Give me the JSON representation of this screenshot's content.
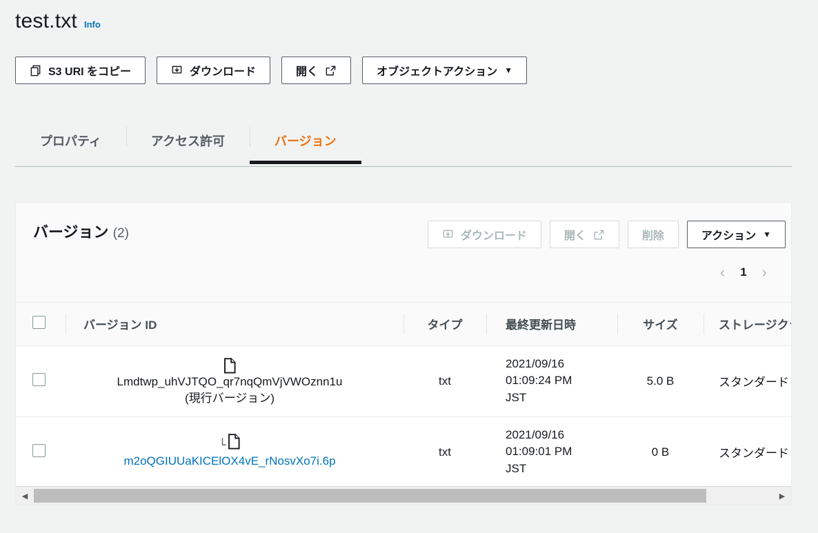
{
  "header": {
    "title": "test.txt",
    "info_label": "Info"
  },
  "toolbar": {
    "copy_uri_label": "S3 URI をコピー",
    "copy_uri_icon": "copy-icon",
    "download_label": "ダウンロード",
    "download_icon": "download-icon",
    "open_label": "開く",
    "open_icon": "external-link-icon",
    "object_actions_label": "オブジェクトアクション",
    "object_actions_caret": "▼"
  },
  "tabs": [
    {
      "label": "プロパティ",
      "active": false
    },
    {
      "label": "アクセス許可",
      "active": false
    },
    {
      "label": "バージョン",
      "active": true
    }
  ],
  "panel": {
    "title": "バージョン",
    "count": "(2)",
    "actions": {
      "download_label": "ダウンロード",
      "download_icon": "download-icon",
      "download_disabled": true,
      "open_label": "開く",
      "open_icon": "external-link-icon",
      "open_disabled": true,
      "delete_label": "削除",
      "delete_disabled": true,
      "actions_label": "アクション",
      "actions_caret": "▼"
    },
    "pagination": {
      "prev_icon": "chevron-left-icon",
      "prev_glyph": "‹",
      "page": "1",
      "next_icon": "chevron-right-icon",
      "next_glyph": "›"
    },
    "table": {
      "columns": [
        {
          "key": "checkbox",
          "label": ""
        },
        {
          "key": "version_id",
          "label": "バージョン ID"
        },
        {
          "key": "type",
          "label": "タイプ"
        },
        {
          "key": "last_modified",
          "label": "最終更新日時"
        },
        {
          "key": "size",
          "label": "サイズ"
        },
        {
          "key": "storage_class",
          "label": "ストレージクラス"
        }
      ],
      "rows": [
        {
          "version_id": "Lmdtwp_uhVJTQO_qr7nqQmVjVWOznn1u",
          "version_suffix": "(現行バージョン)",
          "is_link": false,
          "tree_glyph": "",
          "file_icon": "file-icon",
          "type": "txt",
          "date": "2021/09/16",
          "time": "01:09:24 PM",
          "timezone": "JST",
          "size": "5.0 B",
          "storage_class": "スタンダード"
        },
        {
          "version_id": "m2oQGIUUaKICElOX4vE_rNosvXo7i.6p",
          "version_suffix": "",
          "is_link": true,
          "tree_glyph": "└",
          "file_icon": "file-icon",
          "type": "txt",
          "date": "2021/09/16",
          "time": "01:09:01 PM",
          "timezone": "JST",
          "size": "0 B",
          "storage_class": "スタンダード"
        }
      ]
    },
    "scrollbar": {
      "left_glyph": "◀",
      "right_glyph": "▶"
    }
  },
  "colors": {
    "accent": "#ec7211",
    "link": "#0073bb",
    "text": "#16191f",
    "muted": "#545b64",
    "disabled": "#aab7b8"
  }
}
